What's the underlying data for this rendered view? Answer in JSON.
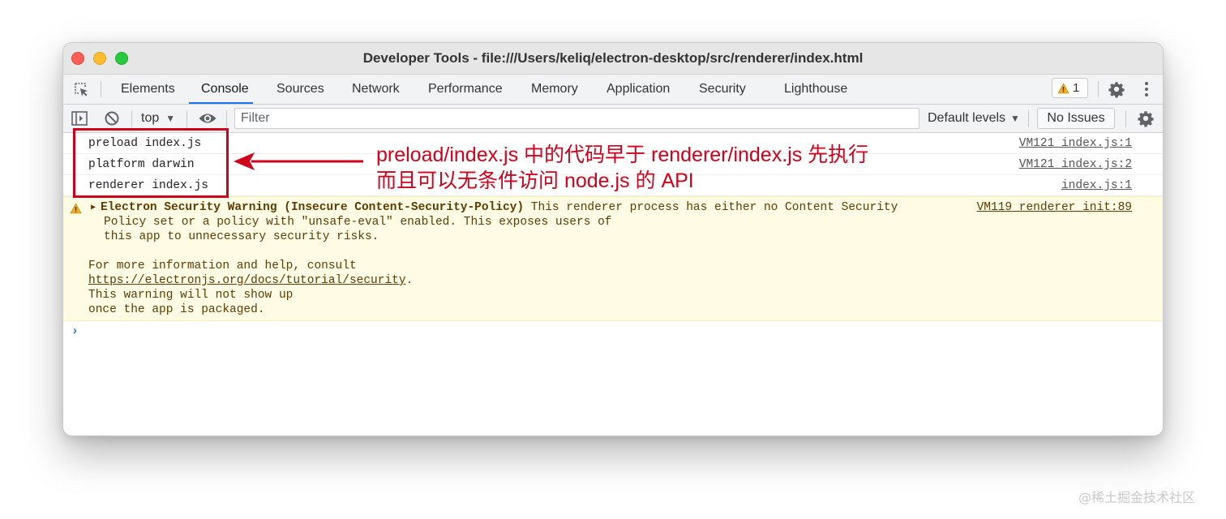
{
  "window": {
    "title": "Developer Tools - file:///Users/keliq/electron-desktop/src/renderer/index.html"
  },
  "tabs": [
    {
      "label": "Elements"
    },
    {
      "label": "Console",
      "active": true
    },
    {
      "label": "Sources"
    },
    {
      "label": "Network"
    },
    {
      "label": "Performance"
    },
    {
      "label": "Memory"
    },
    {
      "label": "Application"
    },
    {
      "label": "Security"
    },
    {
      "label": "Lighthouse"
    }
  ],
  "warnings_count": "1",
  "toolbar": {
    "context": "top",
    "filter_placeholder": "Filter",
    "levels": "Default levels",
    "issues": "No Issues"
  },
  "logs": [
    {
      "message": "preload index.js",
      "source": "VM121 index.js:1"
    },
    {
      "message": "platform darwin",
      "source": "VM121 index.js:2"
    },
    {
      "message": "renderer index.js",
      "source": "index.js:1"
    }
  ],
  "warning": {
    "title": "Electron Security Warning (Insecure Content-Security-Policy)",
    "line1_rest": " This renderer process has either no Content Security",
    "line2": "Policy set or a policy with \"unsafe-eval\" enabled. This exposes users of",
    "line3": "this app to unnecessary security risks.",
    "line4": "For more information and help, consult",
    "link": "https://electronjs.org/docs/tutorial/security",
    "link_suffix": ".",
    "line6": "This warning will not show up",
    "line7": "once the app is packaged.",
    "source": "VM119 renderer_init:89"
  },
  "annotation": {
    "line1": "preload/index.js 中的代码早于 renderer/index.js 先执行",
    "line2": "而且可以无条件访问 node.js 的 API",
    "color": "#d0021b"
  },
  "watermark": "@稀土掘金技术社区",
  "colors": {
    "accent": "#1a73e8",
    "warning_bg": "#fffbe5",
    "warning_text": "#5c3c00",
    "annotation_red": "#d0021b"
  }
}
